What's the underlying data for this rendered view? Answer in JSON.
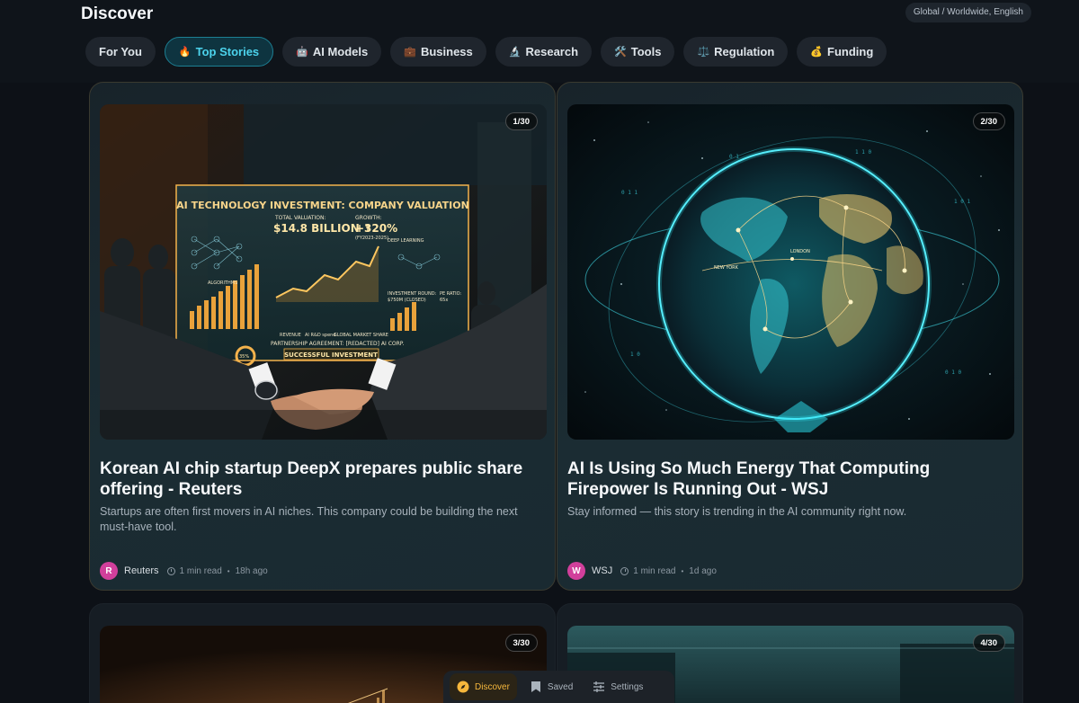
{
  "header": {
    "title": "Discover",
    "region": "Global / Worldwide, English"
  },
  "tabs": [
    {
      "icon": "🔥",
      "label": "Top Stories",
      "active": true
    },
    {
      "icon": "🤖",
      "label": "AI Models"
    },
    {
      "icon": "💼",
      "label": "Business"
    },
    {
      "icon": "🔬",
      "label": "Research"
    },
    {
      "icon": "🛠️",
      "label": "Tools"
    },
    {
      "icon": "⚖️",
      "label": "Regulation"
    },
    {
      "icon": "💰",
      "label": "Funding"
    }
  ],
  "for_you_label": "For You",
  "cards": [
    {
      "counter": "1/30",
      "image_text": {
        "panel_title": "AI TECHNOLOGY INVESTMENT: COMPANY VALUATION",
        "valuation_label": "TOTAL VALUATION:",
        "valuation": "$14.8 BILLION ↑",
        "growth_label": "GROWTH:",
        "growth": "+320%",
        "period": "(FY2023-2025)",
        "deep_learning": "DEEP LEARNING",
        "algorithms": "ALGORITHMS",
        "investment_round": "INVESTMENT ROUND:",
        "round_value": "$750M (CLOSED)",
        "pe_ratio": "PE RATIO:",
        "pe_value": "65x",
        "partnership": "PARTNERSHIP AGREEMENT: [REDACTED] AI CORP.",
        "successful": "SUCCESSFUL INVESTMENT",
        "revenue": "REVENUE",
        "rd_spend": "AI R&D spend",
        "market_share": "GLOBAL MARKET SHARE",
        "percent": "35%"
      },
      "headline": "Korean AI chip startup DeepX prepares public share offering - Reuters",
      "description": "Startups are often first movers in AI niches. This company could be building the next must-have tool.",
      "avatar": "R",
      "source": "Reuters",
      "read_time": "1 min read",
      "age": "18h ago"
    },
    {
      "counter": "2/30",
      "image_text": {
        "city_ny": "NEW YORK",
        "city_london": "LONDON"
      },
      "headline": "AI Is Using So Much Energy That Computing Firepower Is Running Out - WSJ",
      "description": "Stay informed — this story is trending in the AI community right now.",
      "avatar": "W",
      "source": "WSJ",
      "read_time": "1 min read",
      "age": "1d ago"
    },
    {
      "counter": "3/30"
    },
    {
      "counter": "4/30"
    }
  ],
  "bottom_nav": [
    {
      "icon": "compass-icon",
      "label": "Discover",
      "active": true
    },
    {
      "icon": "bookmark-icon",
      "label": "Saved"
    },
    {
      "icon": "sliders-icon",
      "label": "Settings"
    }
  ],
  "colors": {
    "accent_cyan": "#4cd3ec",
    "accent_amber": "#f6b73c",
    "avatar": "#d13f9b"
  }
}
